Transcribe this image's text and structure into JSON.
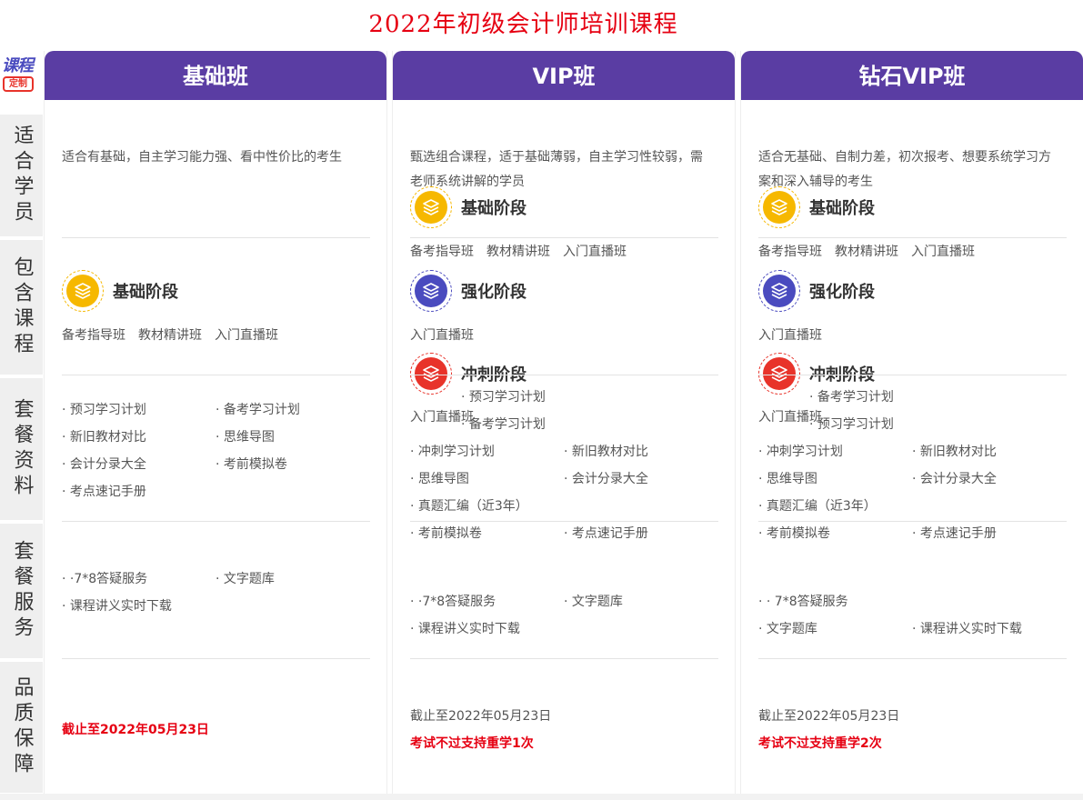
{
  "page": {
    "title": "2022年初级会计师培训课程"
  },
  "logo": {
    "top": "课程",
    "badge": "定制"
  },
  "rows": [
    "适合学员",
    "包含课程",
    "套餐资料",
    "套餐服务",
    "品质保障"
  ],
  "colors": {
    "header": "#5a3da3",
    "stage_basic": "#f6b800",
    "stage_strengthen": "#4a4bbf",
    "stage_sprint": "#e8332a",
    "accent_red": "#e60012"
  },
  "plans": [
    {
      "name": "基础班",
      "suitable": "适合有基础，自主学习能力强、看中性价比的考生",
      "stages": [
        {
          "name": "基础阶段",
          "icon": "layers-icon",
          "courses": [
            "备考指导班",
            "教材精讲班",
            "入门直播班"
          ]
        }
      ],
      "materials": [
        "· 预习学习计划",
        "· 备考学习计划",
        "· 新旧教材对比",
        "· 思维导图",
        "· 会计分录大全",
        "· 考前模拟卷",
        "· 考点速记手册"
      ],
      "services": [
        "· ·7*8答疑服务",
        "· 文字题库",
        "· 课程讲义实时下载"
      ],
      "guarantee": {
        "date": "截止至2022年05月23日"
      }
    },
    {
      "name": "VIP班",
      "suitable": "甄选组合课程，适于基础薄弱，自主学习性较弱，需老师系统讲解的学员",
      "stages": [
        {
          "name": "基础阶段",
          "icon": "layers-icon",
          "courses": [
            "备考指导班",
            "教材精讲班",
            "入门直播班"
          ]
        },
        {
          "name": "强化阶段",
          "icon": "layers-icon",
          "courses": [
            "入门直播班"
          ]
        },
        {
          "name": "冲刺阶段",
          "icon": "layers-icon",
          "courses": [
            "入门直播班"
          ]
        }
      ],
      "overlap": [
        "· 预习学习计划",
        "· 备考学习计划"
      ],
      "materials": [
        "· 冲刺学习计划",
        "· 新旧教材对比",
        "· 思维导图",
        "· 会计分录大全",
        "· 真题汇编（近3年）",
        "· 考前模拟卷",
        "· 考点速记手册"
      ],
      "services": [
        "· ·7*8答疑服务",
        "· 文字题库",
        "· 课程讲义实时下载"
      ],
      "guarantee": {
        "date": "截止至2022年05月23日",
        "note": "考试不过支持重学1次"
      }
    },
    {
      "name": "钻石VIP班",
      "suitable": "适合无基础、自制力差，初次报考、想要系统学习方案和深入辅导的考生",
      "stages": [
        {
          "name": "基础阶段",
          "icon": "layers-icon",
          "courses": [
            "备考指导班",
            "教材精讲班",
            "入门直播班"
          ]
        },
        {
          "name": "强化阶段",
          "icon": "layers-icon",
          "courses": [
            "入门直播班"
          ]
        },
        {
          "name": "冲刺阶段",
          "icon": "layers-icon",
          "courses": [
            "入门直播班"
          ]
        }
      ],
      "overlap": [
        "· 备考学习计划",
        "· 预习学习计划"
      ],
      "materials": [
        "· 冲刺学习计划",
        "· 新旧教材对比",
        "· 思维导图",
        "· 会计分录大全",
        "· 真题汇编（近3年）",
        "· 考前模拟卷",
        "· 考点速记手册"
      ],
      "services": [
        "· · 7*8答疑服务",
        "· 文字题库",
        "· 课程讲义实时下载"
      ],
      "guarantee": {
        "date": "截止至2022年05月23日",
        "note": "考试不过支持重学2次"
      }
    }
  ]
}
